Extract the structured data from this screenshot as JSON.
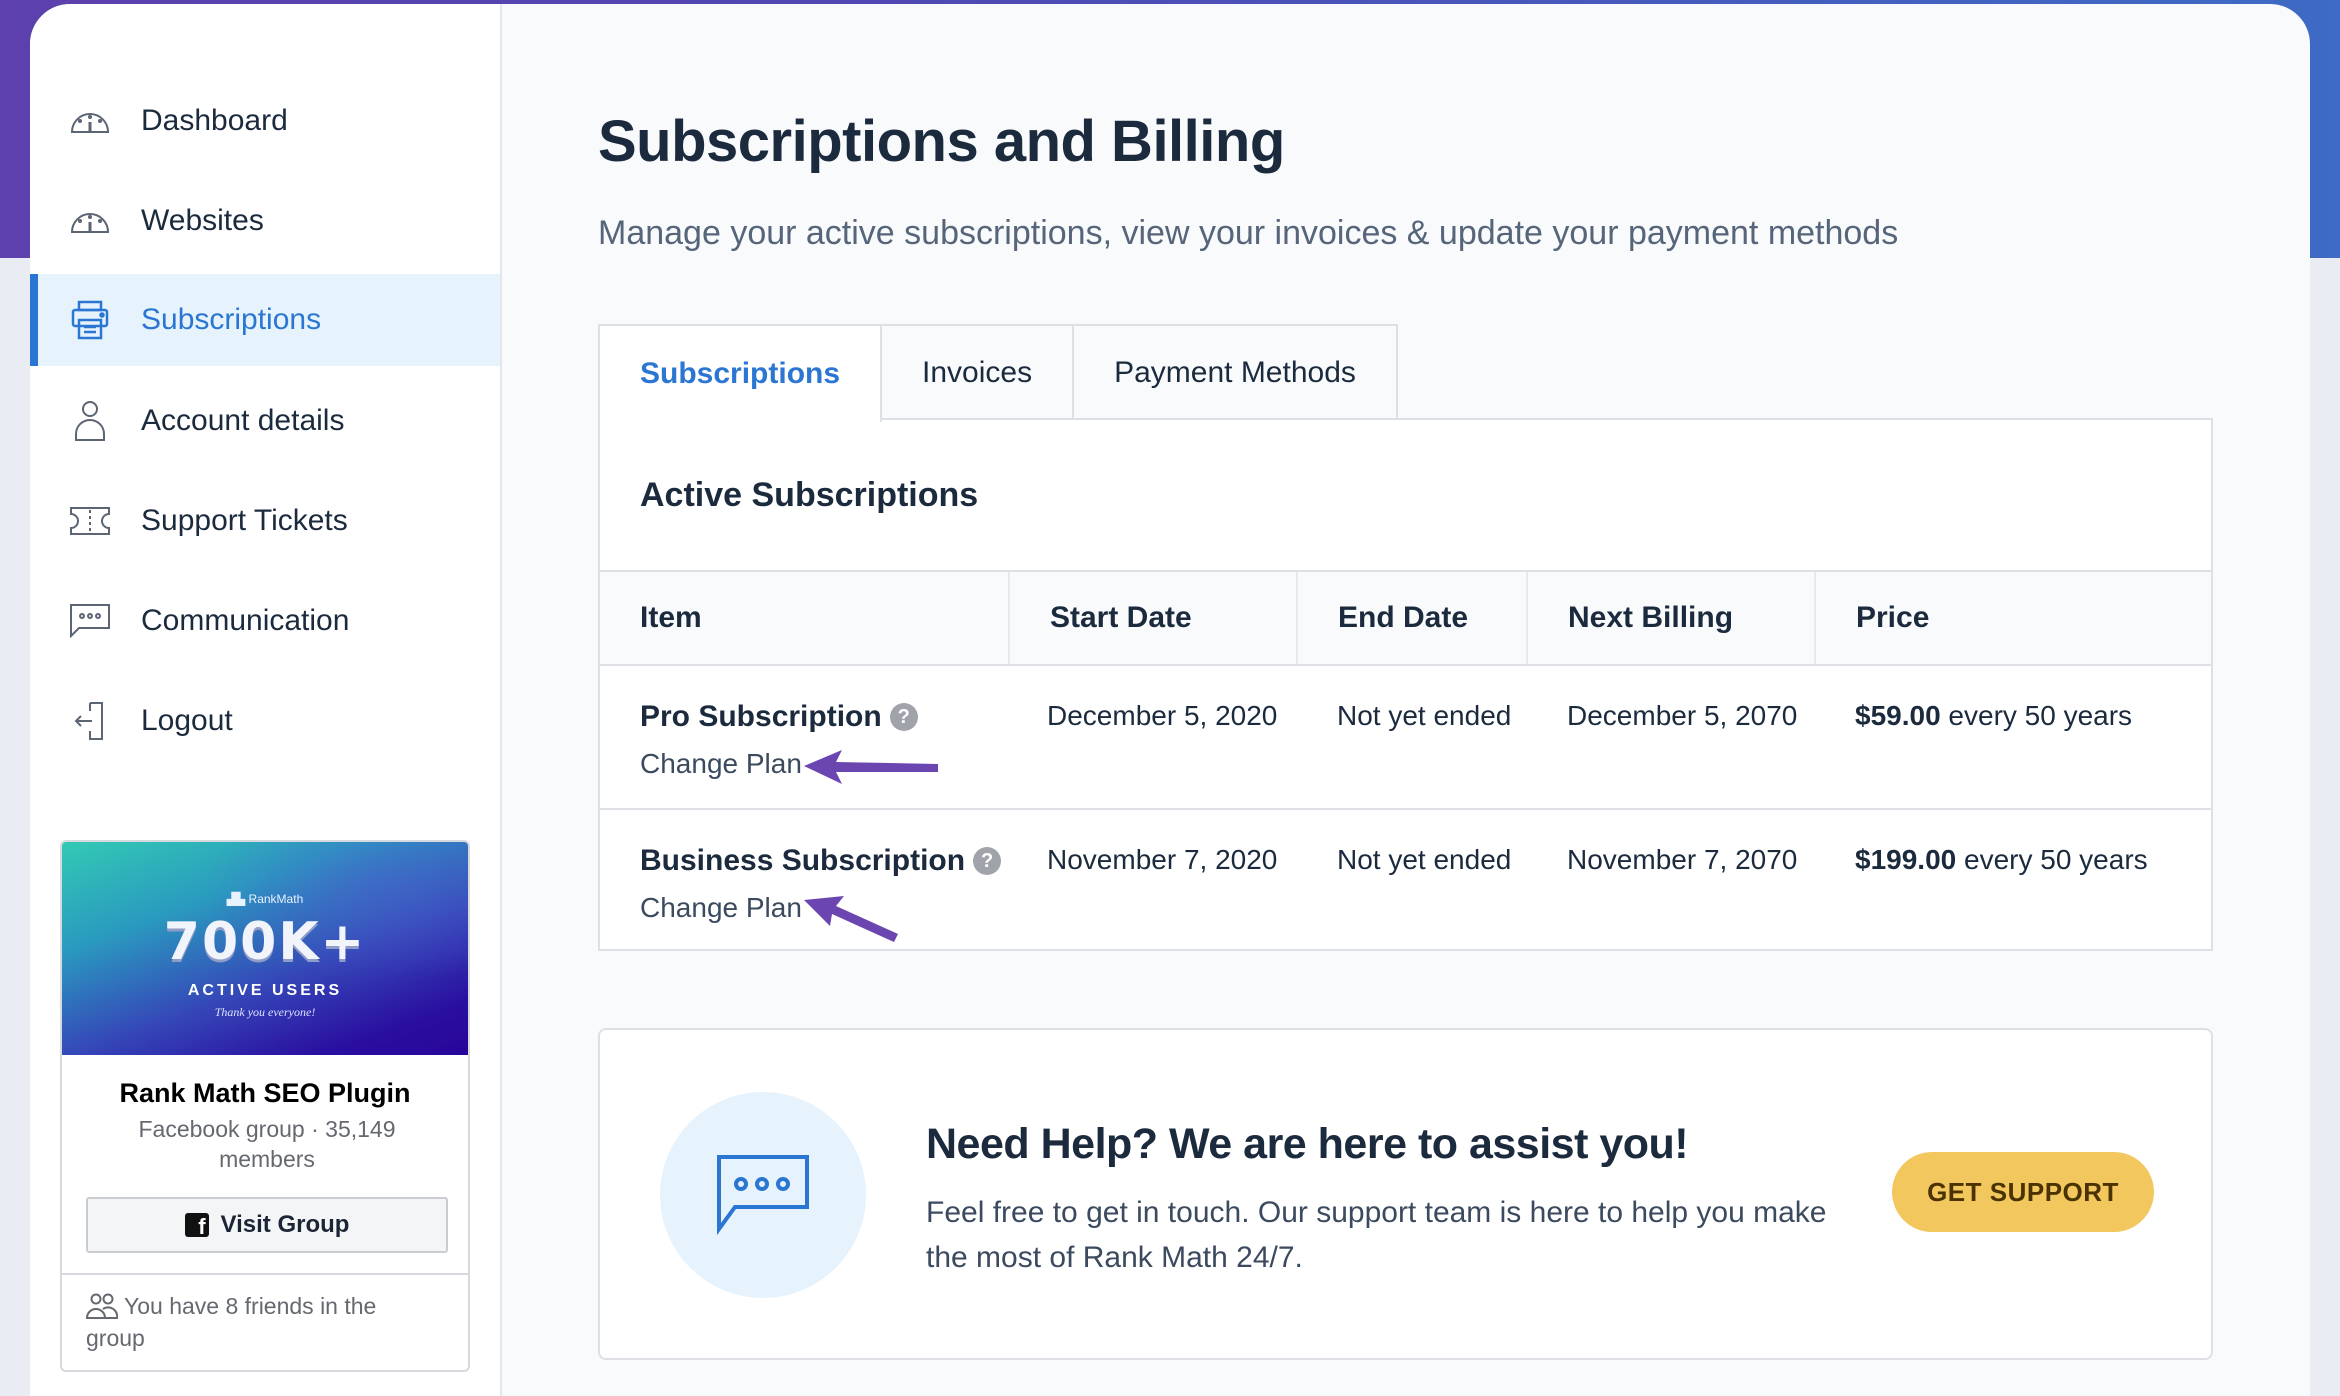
{
  "sidebar": {
    "items": [
      {
        "label": "Dashboard",
        "icon": "dashboard-gauge-icon",
        "active": false
      },
      {
        "label": "Websites",
        "icon": "websites-gauge-icon",
        "active": false
      },
      {
        "label": "Subscriptions",
        "icon": "printer-icon",
        "active": true
      },
      {
        "label": "Account details",
        "icon": "user-icon",
        "active": false
      },
      {
        "label": "Support Tickets",
        "icon": "ticket-icon",
        "active": false
      },
      {
        "label": "Communication",
        "icon": "chat-bubble-icon",
        "active": false
      },
      {
        "label": "Logout",
        "icon": "logout-icon",
        "active": false
      }
    ],
    "facebook_widget": {
      "banner_brand": "RankMath",
      "banner_headline": "700K+",
      "banner_subheadline": "ACTIVE USERS",
      "banner_tagline": "Thank you everyone!",
      "group_name": "Rank Math SEO Plugin",
      "group_meta": "Facebook group · 35,149 members",
      "visit_button": "Visit Group",
      "friends_text": "You have 8 friends in the group"
    }
  },
  "header": {
    "title": "Subscriptions and Billing",
    "subtitle": "Manage your active subscriptions, view your invoices & update your payment methods"
  },
  "tabs": [
    {
      "label": "Subscriptions",
      "active": true
    },
    {
      "label": "Invoices",
      "active": false
    },
    {
      "label": "Payment Methods",
      "active": false
    }
  ],
  "subscriptions": {
    "heading": "Active Subscriptions",
    "columns": [
      "Item",
      "Start Date",
      "End Date",
      "Next Billing",
      "Price"
    ],
    "rows": [
      {
        "item": "Pro Subscription",
        "action": "Change Plan",
        "start_date": "December 5, 2020",
        "end_date": "Not yet ended",
        "next_billing": "December 5, 2070",
        "price_amount": "$59.00",
        "price_period": " every 50 years"
      },
      {
        "item": "Business Subscription",
        "action": "Change Plan",
        "start_date": "November 7, 2020",
        "end_date": "Not yet ended",
        "next_billing": "November 7, 2070",
        "price_amount": "$199.00",
        "price_period": " every 50 years"
      }
    ]
  },
  "help": {
    "title": "Need Help? We are here to assist you!",
    "text": "Feel free to get in touch. Our support team is here to help you make the most of Rank Math 24/7.",
    "button": "GET SUPPORT"
  },
  "colors": {
    "accent": "#2a76d2",
    "active_bg": "#e6f3fd",
    "support_button": "#f1c75e",
    "annotation_arrow": "#6b46b0",
    "header_gradient_start": "#5d40ae",
    "header_gradient_end": "#3e6bc5"
  }
}
